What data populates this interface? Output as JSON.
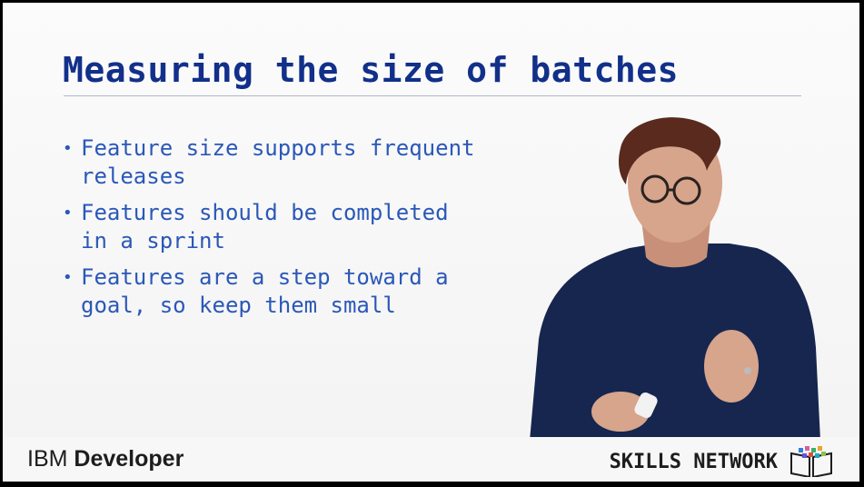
{
  "slide": {
    "title": "Measuring the size of batches",
    "bullets": [
      {
        "text": "Feature size supports frequent\nreleases"
      },
      {
        "text": "Features should be completed\nin a sprint"
      },
      {
        "text": "Features are a step toward a\ngoal, so keep them small"
      }
    ],
    "bullet_symbol": "•"
  },
  "branding": {
    "ibm_prefix": "IBM",
    "ibm_suffix": "Developer",
    "skills_network": "SKILLS NETWORK"
  },
  "colors": {
    "title": "#12308a",
    "bullet_text": "#2a58b8",
    "rule": "#aeb9cc",
    "shirt": "#16264f",
    "hair": "#5a2a1e",
    "skin": "#d7a48c"
  },
  "icons": {
    "presenter": "presenter-video",
    "skills_network_logo": "book-with-dots-icon"
  }
}
